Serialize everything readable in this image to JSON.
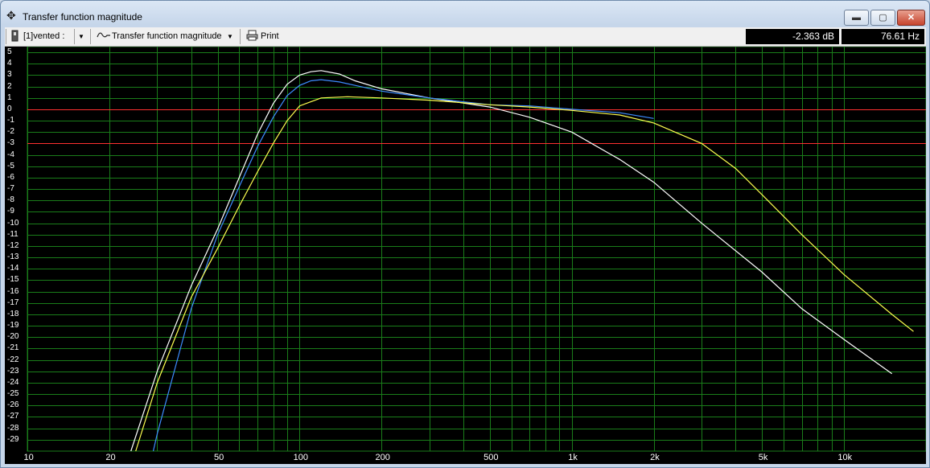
{
  "window": {
    "title": "Transfer function magnitude",
    "buttons": {
      "minimize": "▬",
      "maximize": "▢",
      "close": "✕"
    }
  },
  "toolbar": {
    "source_label": "[1]vented :",
    "measurement_label": "Transfer function magnitude",
    "print_label": "Print",
    "readout_db": "-2.363 dB",
    "readout_hz": "76.61 Hz"
  },
  "icons": {
    "title": "crosshair-icon",
    "source": "speaker-icon",
    "measurement": "waveform-icon",
    "print": "printer-icon",
    "dropdown": "chevron-down-icon"
  },
  "colors": {
    "background": "#000000",
    "grid": "#1a7d1a",
    "reference_lines": "#ff3030",
    "white_curve": "#ffffff",
    "blue_curve": "#3d8cff",
    "yellow_curve": "#ffff50"
  },
  "chart_data": {
    "type": "line",
    "x_scale": "log",
    "xlim": [
      10,
      20000
    ],
    "ylim": [
      -30,
      5.5
    ],
    "grid": true,
    "x_ticks": [
      {
        "value": 10,
        "label": "10"
      },
      {
        "value": 20,
        "label": "20"
      },
      {
        "value": 50,
        "label": "50"
      },
      {
        "value": 100,
        "label": "100"
      },
      {
        "value": 200,
        "label": "200"
      },
      {
        "value": 500,
        "label": "500"
      },
      {
        "value": 1000,
        "label": "1k"
      },
      {
        "value": 2000,
        "label": "2k"
      },
      {
        "value": 5000,
        "label": "5k"
      },
      {
        "value": 10000,
        "label": "10k"
      }
    ],
    "y_ticks": [
      "5",
      "4",
      "3",
      "2",
      "1",
      "0",
      "-1",
      "-2",
      "-3",
      "-4",
      "-5",
      "-6",
      "-7",
      "-8",
      "-9",
      "-10",
      "-11",
      "-12",
      "-13",
      "-14",
      "-15",
      "-16",
      "-17",
      "-18",
      "-19",
      "-20",
      "-21",
      "-22",
      "-23",
      "-24",
      "-25",
      "-26",
      "-27",
      "-28",
      "-29"
    ],
    "y_tick_values": [
      5,
      4,
      3,
      2,
      1,
      0,
      -1,
      -2,
      -3,
      -4,
      -5,
      -6,
      -7,
      -8,
      -9,
      -10,
      -11,
      -12,
      -13,
      -14,
      -15,
      -16,
      -17,
      -18,
      -19,
      -20,
      -21,
      -22,
      -23,
      -24,
      -25,
      -26,
      -27,
      -28,
      -29
    ],
    "reference_lines": [
      0,
      -3
    ],
    "series": [
      {
        "color": "#ffffff",
        "points": [
          [
            24,
            -30
          ],
          [
            30,
            -23
          ],
          [
            40,
            -15.5
          ],
          [
            50,
            -10.5
          ],
          [
            60,
            -6
          ],
          [
            70,
            -2.2
          ],
          [
            80,
            0.5
          ],
          [
            90,
            2.2
          ],
          [
            100,
            3
          ],
          [
            110,
            3.3
          ],
          [
            120,
            3.4
          ],
          [
            140,
            3.1
          ],
          [
            160,
            2.5
          ],
          [
            200,
            1.8
          ],
          [
            300,
            1
          ],
          [
            500,
            0.2
          ],
          [
            700,
            -0.7
          ],
          [
            1000,
            -2
          ],
          [
            1500,
            -4.4
          ],
          [
            2000,
            -6.4
          ],
          [
            3000,
            -10
          ],
          [
            5000,
            -14.3
          ],
          [
            7000,
            -17.5
          ],
          [
            10000,
            -20.2
          ],
          [
            15000,
            -23.2
          ]
        ]
      },
      {
        "color": "#3d8cff",
        "points": [
          [
            29,
            -30
          ],
          [
            30,
            -28.5
          ],
          [
            40,
            -17.5
          ],
          [
            50,
            -11
          ],
          [
            60,
            -6.8
          ],
          [
            70,
            -3.3
          ],
          [
            80,
            -0.7
          ],
          [
            90,
            1.2
          ],
          [
            100,
            2.1
          ],
          [
            110,
            2.5
          ],
          [
            120,
            2.6
          ],
          [
            140,
            2.4
          ],
          [
            160,
            2.1
          ],
          [
            200,
            1.6
          ],
          [
            300,
            1
          ],
          [
            500,
            0.4
          ],
          [
            700,
            0.3
          ],
          [
            1000,
            0
          ],
          [
            1500,
            -0.3
          ],
          [
            2000,
            -0.8
          ]
        ]
      },
      {
        "color": "#ffff50",
        "points": [
          [
            25,
            -30
          ],
          [
            30,
            -24
          ],
          [
            40,
            -16.5
          ],
          [
            50,
            -12.2
          ],
          [
            60,
            -8.5
          ],
          [
            70,
            -5.5
          ],
          [
            80,
            -3
          ],
          [
            90,
            -1
          ],
          [
            100,
            0.3
          ],
          [
            120,
            1
          ],
          [
            150,
            1.1
          ],
          [
            200,
            1
          ],
          [
            300,
            0.8
          ],
          [
            500,
            0.4
          ],
          [
            700,
            0.2
          ],
          [
            1000,
            -0.1
          ],
          [
            1500,
            -0.5
          ],
          [
            2000,
            -1.2
          ],
          [
            3000,
            -3
          ],
          [
            4000,
            -5.2
          ],
          [
            5000,
            -7.5
          ],
          [
            7000,
            -11
          ],
          [
            10000,
            -14.5
          ],
          [
            15000,
            -18
          ],
          [
            18000,
            -19.5
          ]
        ]
      }
    ]
  }
}
